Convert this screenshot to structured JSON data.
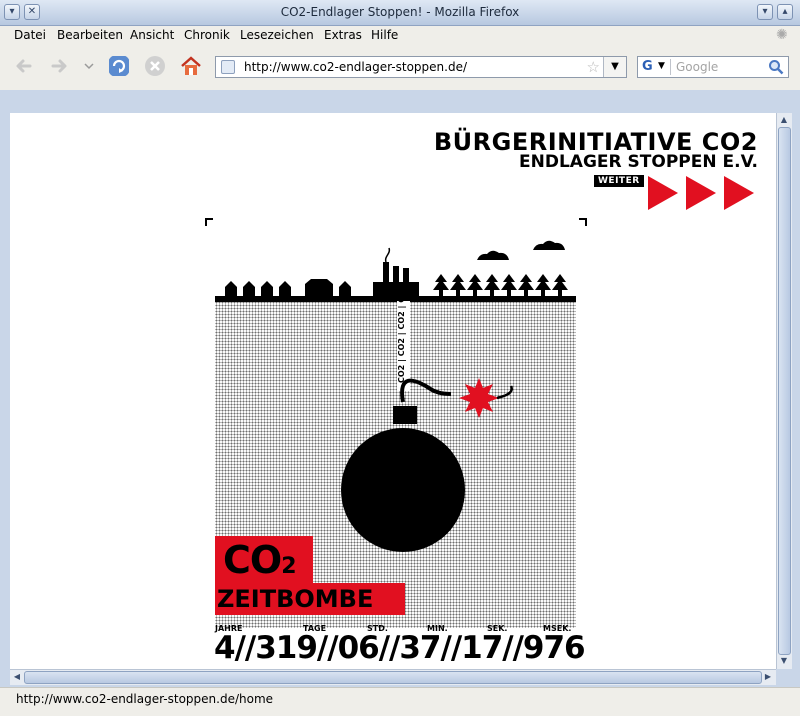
{
  "window": {
    "title": "CO2-Endlager Stoppen! - Mozilla Firefox"
  },
  "menubar": {
    "items": [
      "Datei",
      "Bearbeiten",
      "Ansicht",
      "Chronik",
      "Lesezeichen",
      "Extras",
      "Hilfe"
    ]
  },
  "toolbar": {
    "url": "http://www.co2-endlager-stoppen.de/",
    "search_placeholder": "Google",
    "search_engine": "G"
  },
  "page": {
    "org_line1": "BÜRGERINITIATIVE CO2",
    "org_line2": "ENDLAGER STOPPEN E.V.",
    "weiter_label": "WEITER",
    "pipe_text": "CO2 | CO2 | CO2 | C",
    "badge_co": "CO",
    "badge_sub": "2",
    "badge_title": "ZEITBOMBE",
    "time_labels": [
      "JAHRE",
      "TAGE",
      "STD.",
      "MIN.",
      "SEK.",
      "MSEK."
    ],
    "countdown": "4//319//06//37//17//976",
    "accent_color": "#e11020"
  },
  "statusbar": {
    "text": "http://www.co2-endlager-stoppen.de/home"
  },
  "icons": [
    "back-icon",
    "forward-icon",
    "history-dropdown-icon",
    "reload-icon",
    "stop-icon",
    "home-icon",
    "favicon-icon",
    "bookmark-star-icon",
    "search-magnifier-icon"
  ]
}
